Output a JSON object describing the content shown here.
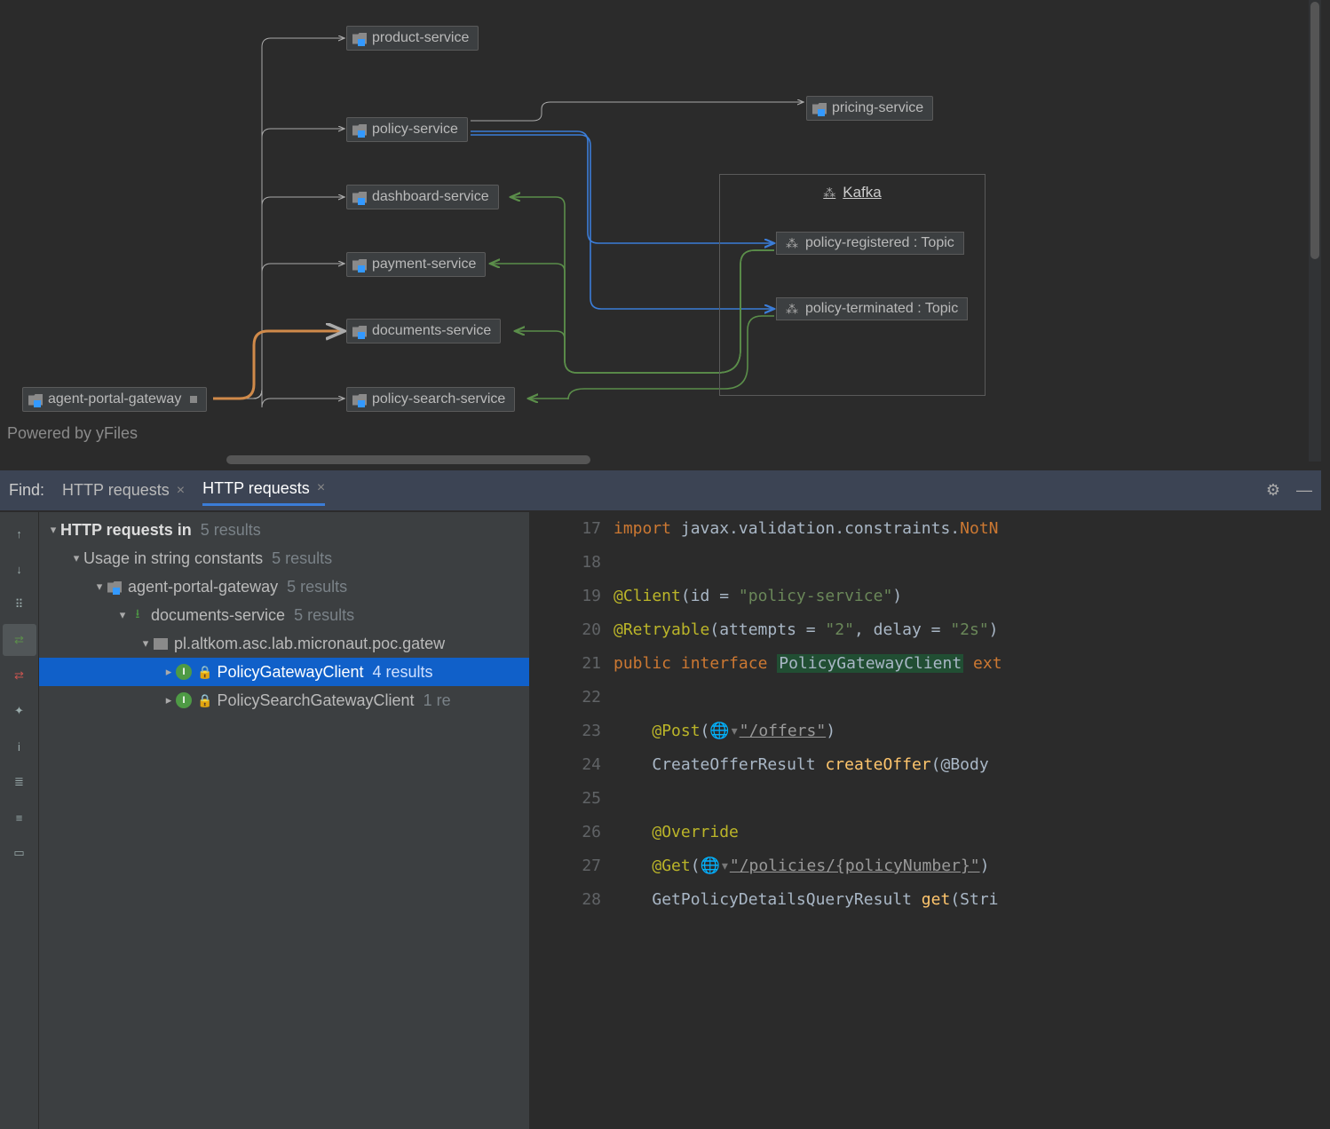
{
  "diagram": {
    "nodes": {
      "agent_portal_gateway": "agent-portal-gateway",
      "product_service": "product-service",
      "policy_service": "policy-service",
      "dashboard_service": "dashboard-service",
      "payment_service": "payment-service",
      "documents_service": "documents-service",
      "policy_search_service": "policy-search-service",
      "pricing_service": "pricing-service"
    },
    "kafka": {
      "title": "Kafka",
      "topic1": "policy-registered  : Topic",
      "topic2": "policy-terminated  : Topic"
    },
    "powered": "Powered by yFiles"
  },
  "find": {
    "label": "Find:",
    "tab1": "HTTP requests",
    "tab2": "HTTP requests"
  },
  "tree": {
    "root": "HTTP requests in",
    "root_count": "5 results",
    "usage": "Usage in string constants",
    "usage_count": "5 results",
    "agw": "agent-portal-gateway",
    "agw_count": "5 results",
    "docs": "documents-service",
    "docs_count": "5 results",
    "pkg": "pl.altkom.asc.lab.micronaut.poc.gatew",
    "pgc": "PolicyGatewayClient",
    "pgc_count": "4 results",
    "psgc": "PolicySearchGatewayClient",
    "psgc_count": "1 re"
  },
  "code": {
    "l17_import": "import",
    "l17_rest": " javax.validation.constraints.",
    "l17_notn": "NotN",
    "l19_ann": "@Client",
    "l19_rest1": "(id = ",
    "l19_str": "\"policy-service\"",
    "l19_rest2": ")",
    "l20_ann": "@Retryable",
    "l20_rest1": "(attempts = ",
    "l20_str1": "\"2\"",
    "l20_rest2": ", delay = ",
    "l20_str2": "\"2s\"",
    "l20_rest3": ")",
    "l21_kw1": "public",
    "l21_kw2": "interface",
    "l21_name": "PolicyGatewayClient",
    "l21_kw3": "ext",
    "l23_ann": "@Post",
    "l23_link": "\"/offers\"",
    "l24_ret": "CreateOfferResult ",
    "l24_fn": "createOffer",
    "l24_rest": "(@Body ",
    "l26_ann": "@Override",
    "l27_ann": "@Get",
    "l27_link": "\"/policies/{policyNumber}\"",
    "l28_ret": "GetPolicyDetailsQueryResult ",
    "l28_fn": "get",
    "l28_rest": "(Stri"
  },
  "lines": [
    "17",
    "18",
    "19",
    "20",
    "21",
    "22",
    "23",
    "24",
    "25",
    "26",
    "27",
    "28"
  ]
}
